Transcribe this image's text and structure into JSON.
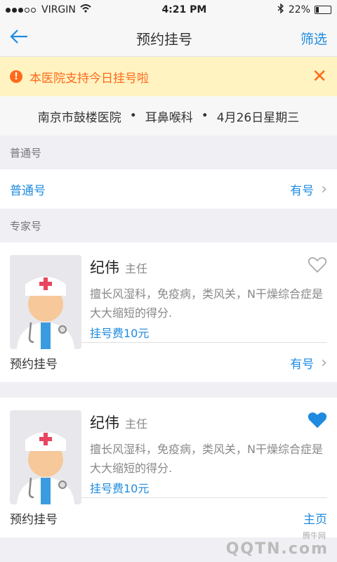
{
  "status_bar": {
    "carrier": "VIRGIN",
    "time": "4:21 PM",
    "battery_percent": "22%"
  },
  "nav": {
    "title": "预约挂号",
    "filter_label": "筛选",
    "back_icon": "arrow-left-icon"
  },
  "notice": {
    "text": "本医院支持今日挂号啦",
    "close_icon": "close-icon"
  },
  "hospital_line": {
    "hospital": "南京市鼓楼医院",
    "sep": "•",
    "department": "耳鼻喉科",
    "date": "4月26日星期三"
  },
  "general": {
    "section_title": "普通号",
    "row_label": "普通号",
    "availability": "有号"
  },
  "experts": {
    "section_title": "专家号",
    "doctors": [
      {
        "name": "纪伟",
        "rank": "主任",
        "desc": "擅长风湿科，免疫病，类风关，N干燥综合症是大大缩短的得分.",
        "fee": "挂号费10元",
        "favorite": false,
        "book_label": "预约挂号",
        "availability": "有号"
      },
      {
        "name": "纪伟",
        "rank": "主任",
        "desc": "擅长风湿科，免疫病，类风关，N干燥综合症是大大缩短的得分.",
        "fee": "挂号费10元",
        "favorite": true,
        "book_label": "预约挂号",
        "availability": "主页"
      }
    ]
  },
  "watermark": {
    "top": "腾牛网",
    "main": "QQTN.com"
  },
  "colors": {
    "accent": "#1e8be0",
    "warning": "#ff6a1a",
    "notice_bg": "#fff3c2"
  }
}
